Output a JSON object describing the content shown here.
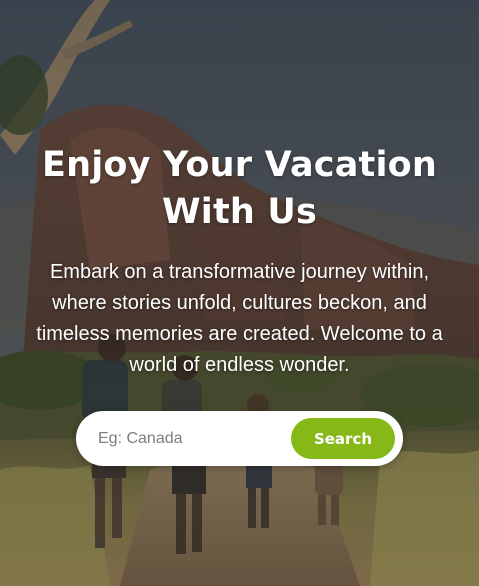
{
  "hero": {
    "title": "Enjoy Your Vacation With Us",
    "subtitle": "Embark on a transformative journey within, where stories unfold, cultures beckon, and timeless memories are created. Welcome to a world of endless wonder."
  },
  "search": {
    "placeholder": "Eg: Canada",
    "value": "",
    "button_label": "Search"
  },
  "colors": {
    "accent": "#86b817",
    "text": "#ffffff"
  },
  "background": {
    "icon": "hikers-landscape-photo"
  }
}
